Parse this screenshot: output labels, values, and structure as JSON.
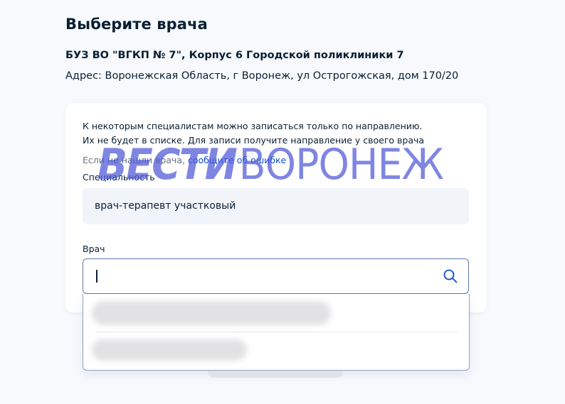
{
  "page": {
    "title": "Выберите врача"
  },
  "clinic": {
    "name": "БУЗ ВО \"ВГКП № 7\", Корпус 6 Городской поликлиники 7",
    "address": "Адрес: Воронежская Область, г Воронеж, ул Острогожская, дом 170/20"
  },
  "notice": {
    "line1": "К некоторым специалистам можно записаться только по направлению.",
    "line2": "Их не будет в списке. Для записи получите направление у своего врача",
    "report_prefix": "Если не нашли врача, ",
    "report_link": "сообщите об ошибке"
  },
  "specialty": {
    "label": "Специальность",
    "value": "врач-терапевт участковый"
  },
  "doctor": {
    "label": "Врач",
    "value": "",
    "placeholder": ""
  },
  "icons": {
    "search": "search-icon"
  },
  "colors": {
    "link": "#0d4cd3",
    "field_border": "#5f7aaa",
    "watermark": "#4d58d6"
  },
  "watermark": {
    "bold": "ВЕСТИ",
    "light": "ВОРОНЕЖ"
  }
}
